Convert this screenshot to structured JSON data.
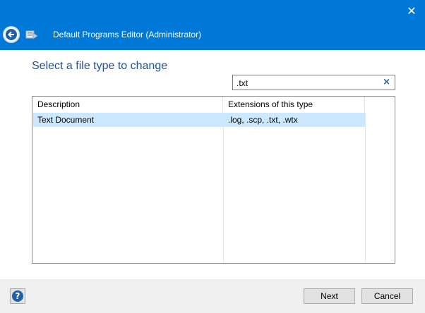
{
  "window": {
    "title": "Default Programs Editor (Administrator)",
    "accent": "#0078d7"
  },
  "icons": {
    "close": "close-icon",
    "back": "back-arrow-icon",
    "app": "app-icon",
    "clear": "clear-icon",
    "help": "help-icon"
  },
  "main": {
    "heading": "Select a file type to change",
    "search": {
      "value": ".txt",
      "clear_glyph": "×"
    },
    "table": {
      "columns": [
        "Description",
        "Extensions of this type"
      ],
      "rows": [
        {
          "description": "Text Document",
          "extensions": ".log, .scp, .txt, .wtx",
          "selected": true
        }
      ]
    }
  },
  "footer": {
    "help_glyph": "?",
    "next_label": "Next",
    "cancel_label": "Cancel"
  }
}
